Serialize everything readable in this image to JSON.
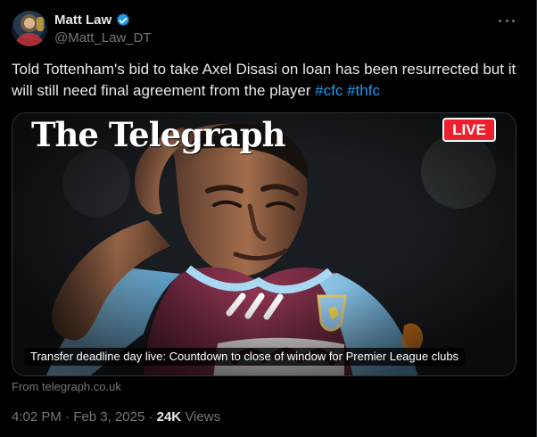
{
  "user": {
    "display_name": "Matt Law",
    "handle": "@Matt_Law_DT",
    "verified_icon": "verified-badge-icon",
    "avatar_icon": "profile-avatar"
  },
  "tweet": {
    "text_main": "Told Tottenham's bid to take Axel Disasi on loan has been resurrected but it will still need final agreement from the player",
    "hashtags": [
      "#cfc",
      "#thfc"
    ]
  },
  "media": {
    "brand": "The Telegraph",
    "live_label": "LIVE",
    "caption": "Transfer deadline day live: Countdown to close of window for Premier League clubs",
    "source": "From telegraph.co.uk"
  },
  "meta": {
    "time": "4:02 PM",
    "separator": " · ",
    "date": "Feb 3, 2025",
    "views_count": "24K",
    "views_label": " Views"
  },
  "colors": {
    "background": "#000000",
    "text": "#e7e9ea",
    "muted": "#71767b",
    "link": "#1d9bf0",
    "live": "#ef1f2d",
    "jersey": "#7a2f49"
  }
}
